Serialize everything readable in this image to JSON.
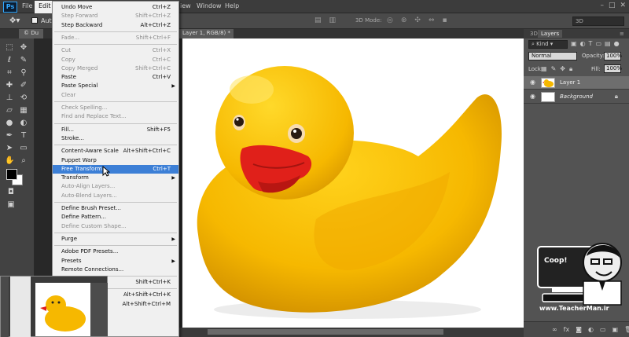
{
  "menubar": {
    "logo": "Ps",
    "items": [
      {
        "label": "File",
        "active": false
      },
      {
        "label": "Edit",
        "active": true
      },
      {
        "label": "iew",
        "active": false
      },
      {
        "label": "Window",
        "active": false
      },
      {
        "label": "Help",
        "active": false
      }
    ]
  },
  "options": {
    "auto_select_label": "Auto-",
    "mode_3d_label": "3D Mode:",
    "workspace": "3D"
  },
  "tabs": {
    "doc_tab_prefix": "© Du",
    "doc_tab_suffix": "Layer 1, RGB/8) *"
  },
  "edit_menu": {
    "items": [
      {
        "label": "Undo Move",
        "shortcut": "Ctrl+Z",
        "enabled": true
      },
      {
        "label": "Step Forward",
        "shortcut": "Shift+Ctrl+Z",
        "enabled": false
      },
      {
        "label": "Step Backward",
        "shortcut": "Alt+Ctrl+Z",
        "enabled": true
      },
      {
        "sep": true
      },
      {
        "label": "Fade...",
        "shortcut": "Shift+Ctrl+F",
        "enabled": false
      },
      {
        "sep": true
      },
      {
        "label": "Cut",
        "shortcut": "Ctrl+X",
        "enabled": false
      },
      {
        "label": "Copy",
        "shortcut": "Ctrl+C",
        "enabled": false
      },
      {
        "label": "Copy Merged",
        "shortcut": "Shift+Ctrl+C",
        "enabled": false
      },
      {
        "label": "Paste",
        "shortcut": "Ctrl+V",
        "enabled": true
      },
      {
        "label": "Paste Special",
        "submenu": true,
        "enabled": true
      },
      {
        "label": "Clear",
        "enabled": false
      },
      {
        "sep": true
      },
      {
        "label": "Check Spelling...",
        "enabled": false
      },
      {
        "label": "Find and Replace Text...",
        "enabled": false
      },
      {
        "sep": true
      },
      {
        "label": "Fill...",
        "shortcut": "Shift+F5",
        "enabled": true
      },
      {
        "label": "Stroke...",
        "enabled": true
      },
      {
        "sep": true
      },
      {
        "label": "Content-Aware Scale",
        "shortcut": "Alt+Shift+Ctrl+C",
        "enabled": true
      },
      {
        "label": "Puppet Warp",
        "enabled": true
      },
      {
        "label": "Free Transform",
        "shortcut": "Ctrl+T",
        "enabled": true,
        "highlighted": true
      },
      {
        "label": "Transform",
        "submenu": true,
        "enabled": true
      },
      {
        "label": "Auto-Align Layers...",
        "enabled": false
      },
      {
        "label": "Auto-Blend Layers...",
        "enabled": false
      },
      {
        "sep": true
      },
      {
        "label": "Define Brush Preset...",
        "enabled": true
      },
      {
        "label": "Define Pattern...",
        "enabled": true
      },
      {
        "label": "Define Custom Shape...",
        "enabled": false
      },
      {
        "sep": true
      },
      {
        "label": "Purge",
        "submenu": true,
        "enabled": true
      },
      {
        "sep": true
      },
      {
        "label": "Adobe PDF Presets...",
        "enabled": true
      },
      {
        "label": "Presets",
        "submenu": true,
        "enabled": true
      },
      {
        "label": "Remote Connections...",
        "enabled": true
      },
      {
        "sep": true
      },
      {
        "label": "",
        "shortcut": "Shift+Ctrl+K",
        "enabled": true
      },
      {
        "sep": true
      },
      {
        "label": "",
        "shortcut": "Alt+Shift+Ctrl+K",
        "enabled": true
      },
      {
        "label": "",
        "shortcut": "Alt+Shift+Ctrl+M",
        "enabled": true
      }
    ]
  },
  "layers_panel": {
    "tab_3d": "3D",
    "tab_layers": "Layers",
    "kind": "Kind",
    "blend_mode": "Normal",
    "opacity_label": "Opacity:",
    "opacity": "100%",
    "lock_label": "Lock:",
    "fill_label": "Fill:",
    "fill": "100%",
    "layers": [
      {
        "name": "Layer 1",
        "selected": true,
        "italic": false
      },
      {
        "name": "Background",
        "selected": false,
        "italic": true,
        "locked": true
      }
    ]
  },
  "watermark": {
    "url": "www.TeacherMan.ir"
  },
  "colors": {
    "menu_highlight": "#3c7fd6",
    "duck_yellow": "#f6b800",
    "beak_red": "#e0201a"
  }
}
